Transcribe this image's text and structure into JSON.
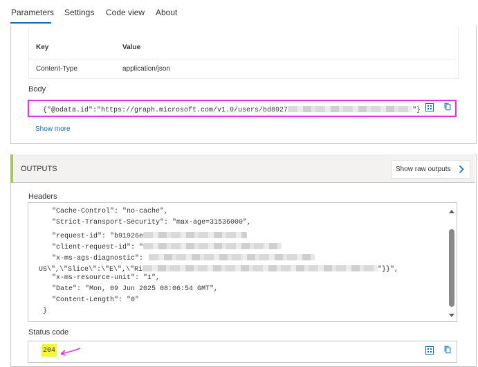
{
  "tabs": [
    {
      "label": "Parameters",
      "active": true
    },
    {
      "label": "Settings",
      "active": false
    },
    {
      "label": "Code view",
      "active": false
    },
    {
      "label": "About",
      "active": false
    }
  ],
  "request": {
    "headers_table": {
      "columns": [
        "Key",
        "Value"
      ],
      "rows": [
        {
          "key": "Content-Type",
          "value": "application/json"
        }
      ]
    },
    "body_label": "Body",
    "body_text_prefix": "{\"@odata.id\":\"https://graph.microsoft.com/v1.0/users/bd8927",
    "body_text_suffix": "\"}",
    "show_more_label": "Show more"
  },
  "outputs": {
    "title": "OUTPUTS",
    "show_raw_label": "Show raw outputs",
    "headers_label": "Headers",
    "header_lines": [
      "\"Cache-Control\": \"no-cache\",",
      "\"Strict-Transport-Security\": \"max-age=31536000\",",
      "\"request-id\": \"b91926e",
      "\"client-request-id\": \"",
      "\"x-ms-ags-diagnostic\":",
      "US\\\",\\\"Slice\\\":\\\"E\\\",\\\"Ri",
      "\"x-ms-resource-unit\": \"1\",",
      "\"Date\": \"Mon, 09 Jun 2025 08:06:54 GMT\",",
      "\"Content-Length\": \"0\"",
      "}"
    ],
    "line_5_suffix": "\"}}\",",
    "status_code_label": "Status code",
    "status_code_value": "204"
  },
  "colors": {
    "accent_blue": "#0f6cbd",
    "highlight_magenta": "#e62ee6",
    "status_highlight": "#f6f63f",
    "outputs_accent": "#a6c75a"
  }
}
